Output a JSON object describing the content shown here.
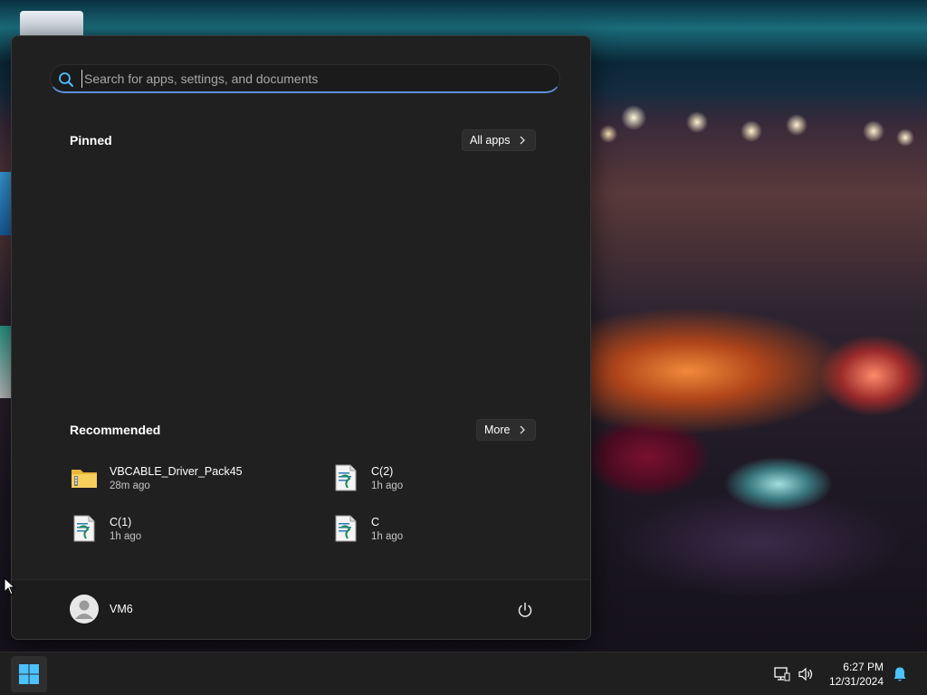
{
  "search": {
    "placeholder": "Search for apps, settings, and documents"
  },
  "pinned": {
    "title": "Pinned",
    "all_apps_label": "All apps"
  },
  "recommended": {
    "title": "Recommended",
    "more_label": "More",
    "items": [
      {
        "name": "VBCABLE_Driver_Pack45",
        "time": "28m ago",
        "icon": "zip-folder-icon"
      },
      {
        "name": "C(2)",
        "time": "1h ago",
        "icon": "text-file-icon"
      },
      {
        "name": "C(1)",
        "time": "1h ago",
        "icon": "text-file-icon"
      },
      {
        "name": "C",
        "time": "1h ago",
        "icon": "text-file-icon"
      }
    ]
  },
  "user": {
    "name": "VM6"
  },
  "taskbar": {
    "time": "6:27 PM",
    "date": "12/31/2024"
  },
  "colors": {
    "menu_bg": "#202020",
    "accent": "#5c8fd6",
    "start_blue": "#4cc2ff"
  }
}
